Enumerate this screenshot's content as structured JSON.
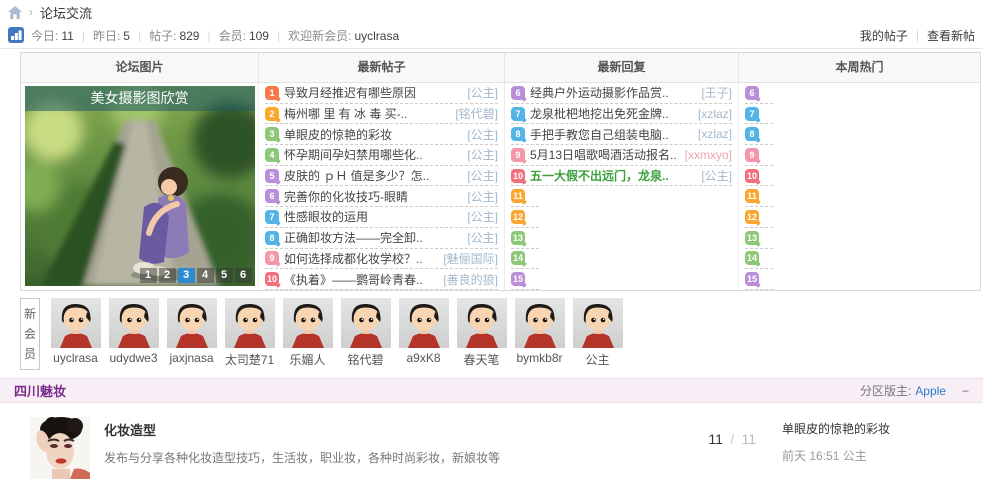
{
  "colors": {
    "orange_red": "#f8794c",
    "orange": "#fba62f",
    "green": "#8cc878",
    "purple": "#ba8fd8",
    "blue": "#55b4e6",
    "pink": "#f497aa",
    "red": "#f26f7e",
    "pager_active": "#2e8bd0",
    "section_purple": "#7b2d8b",
    "moderator_link": "#2b7acd",
    "author_default": "#a3b8cc",
    "author_pink": "#f0a2ac",
    "reply_highlight_green": "#3ba03b"
  },
  "breadcrumb": {
    "home_icon": "home-icon",
    "separator": "›",
    "section": "论坛交流"
  },
  "statsbar": {
    "stats": [
      {
        "label": "今日:",
        "value": "11"
      },
      {
        "label": "昨日:",
        "value": "5"
      },
      {
        "label": "帖子:",
        "value": "829"
      },
      {
        "label": "会员:",
        "value": "109"
      }
    ],
    "welcome_label": "欢迎新会员:",
    "welcome_user": "uyclrasa",
    "my_posts": "我的帖子",
    "view_new": "查看新帖"
  },
  "board": {
    "headers": [
      "论坛图片",
      "最新帖子",
      "最新回复",
      "本周热门"
    ],
    "photo": {
      "title": "美女摄影图欣赏",
      "pages": [
        "1",
        "2",
        "3",
        "4",
        "5",
        "6"
      ],
      "active_page": "3"
    },
    "latest_posts": [
      {
        "n": "1",
        "c": "orange_red",
        "title": "导致月经推迟有哪些原因",
        "author": "公主"
      },
      {
        "n": "2",
        "c": "orange",
        "title": "梅州哪 里 有 冰 毒 买-..",
        "author": "铭代碧"
      },
      {
        "n": "3",
        "c": "green",
        "title": "单眼皮的惊艳的彩妆",
        "author": "公主"
      },
      {
        "n": "4",
        "c": "green",
        "title": "怀孕期间孕妇禁用哪些化..",
        "author": "公主"
      },
      {
        "n": "5",
        "c": "purple",
        "title": "皮肤的 ｐＨ 值是多少？怎..",
        "author": "公主"
      },
      {
        "n": "6",
        "c": "purple",
        "title": "完善你的化妆技巧-眼睛",
        "author": "公主"
      },
      {
        "n": "7",
        "c": "blue",
        "title": "性感眼妆的运用",
        "author": "公主"
      },
      {
        "n": "8",
        "c": "blue",
        "title": "正确卸妆方法——完全卸..",
        "author": "公主"
      },
      {
        "n": "9",
        "c": "pink",
        "title": "如何选择成都化妆学校？..",
        "author": "魅俪国际"
      },
      {
        "n": "10",
        "c": "red",
        "title": "《执着》——鹦哥岭青春..",
        "author": "善良的狼"
      }
    ],
    "latest_replies": [
      {
        "n": "6",
        "c": "purple",
        "title": "经典户外运动摄影作品赏..",
        "author": "王子"
      },
      {
        "n": "7",
        "c": "blue",
        "title": "龙泉枇杷地挖出免死金牌..",
        "author": "xzlaz"
      },
      {
        "n": "8",
        "c": "blue",
        "title": "手把手教您自己组装电脑..",
        "author": "xzlaz"
      },
      {
        "n": "9",
        "c": "pink",
        "title": "5月13日唱歌喝酒活动报名..",
        "author": "xxmxyo",
        "author_style": "pink"
      },
      {
        "n": "10",
        "c": "red",
        "title": "五一大假不出远门，龙泉..",
        "author": "公主",
        "title_style": "green"
      },
      {
        "n": "11",
        "c": "orange"
      },
      {
        "n": "12",
        "c": "orange"
      },
      {
        "n": "13",
        "c": "green"
      },
      {
        "n": "14",
        "c": "green"
      },
      {
        "n": "15",
        "c": "purple"
      }
    ],
    "weekly_hot": [
      {
        "n": "6",
        "c": "purple"
      },
      {
        "n": "7",
        "c": "blue"
      },
      {
        "n": "8",
        "c": "blue"
      },
      {
        "n": "9",
        "c": "pink"
      },
      {
        "n": "10",
        "c": "red"
      },
      {
        "n": "11",
        "c": "orange"
      },
      {
        "n": "12",
        "c": "orange"
      },
      {
        "n": "13",
        "c": "green"
      },
      {
        "n": "14",
        "c": "green"
      },
      {
        "n": "15",
        "c": "purple"
      }
    ]
  },
  "new_members": {
    "label": "新会员",
    "members": [
      "uyclrasa",
      "udydwe3",
      "jaxjnasa",
      "太司楚71",
      "乐媚人",
      "铭代碧",
      "a9xK8",
      "春天笔",
      "bymkb8r",
      "公主"
    ]
  },
  "section_header": {
    "title": "四川魅妆",
    "moderator_label": "分区版主:",
    "moderator": "Apple",
    "collapse": "−"
  },
  "forum_row": {
    "title": "化妆造型",
    "description": "发布与分享各种化妆造型技巧，生活妆，职业妆，各种时尚彩妆，新娘妆等",
    "topics": "11",
    "stats_separator": "/",
    "posts": "11",
    "last_post_title": "单眼皮的惊艳的彩妆",
    "last_post_meta": "前天 16:51",
    "last_post_author": "公主"
  }
}
